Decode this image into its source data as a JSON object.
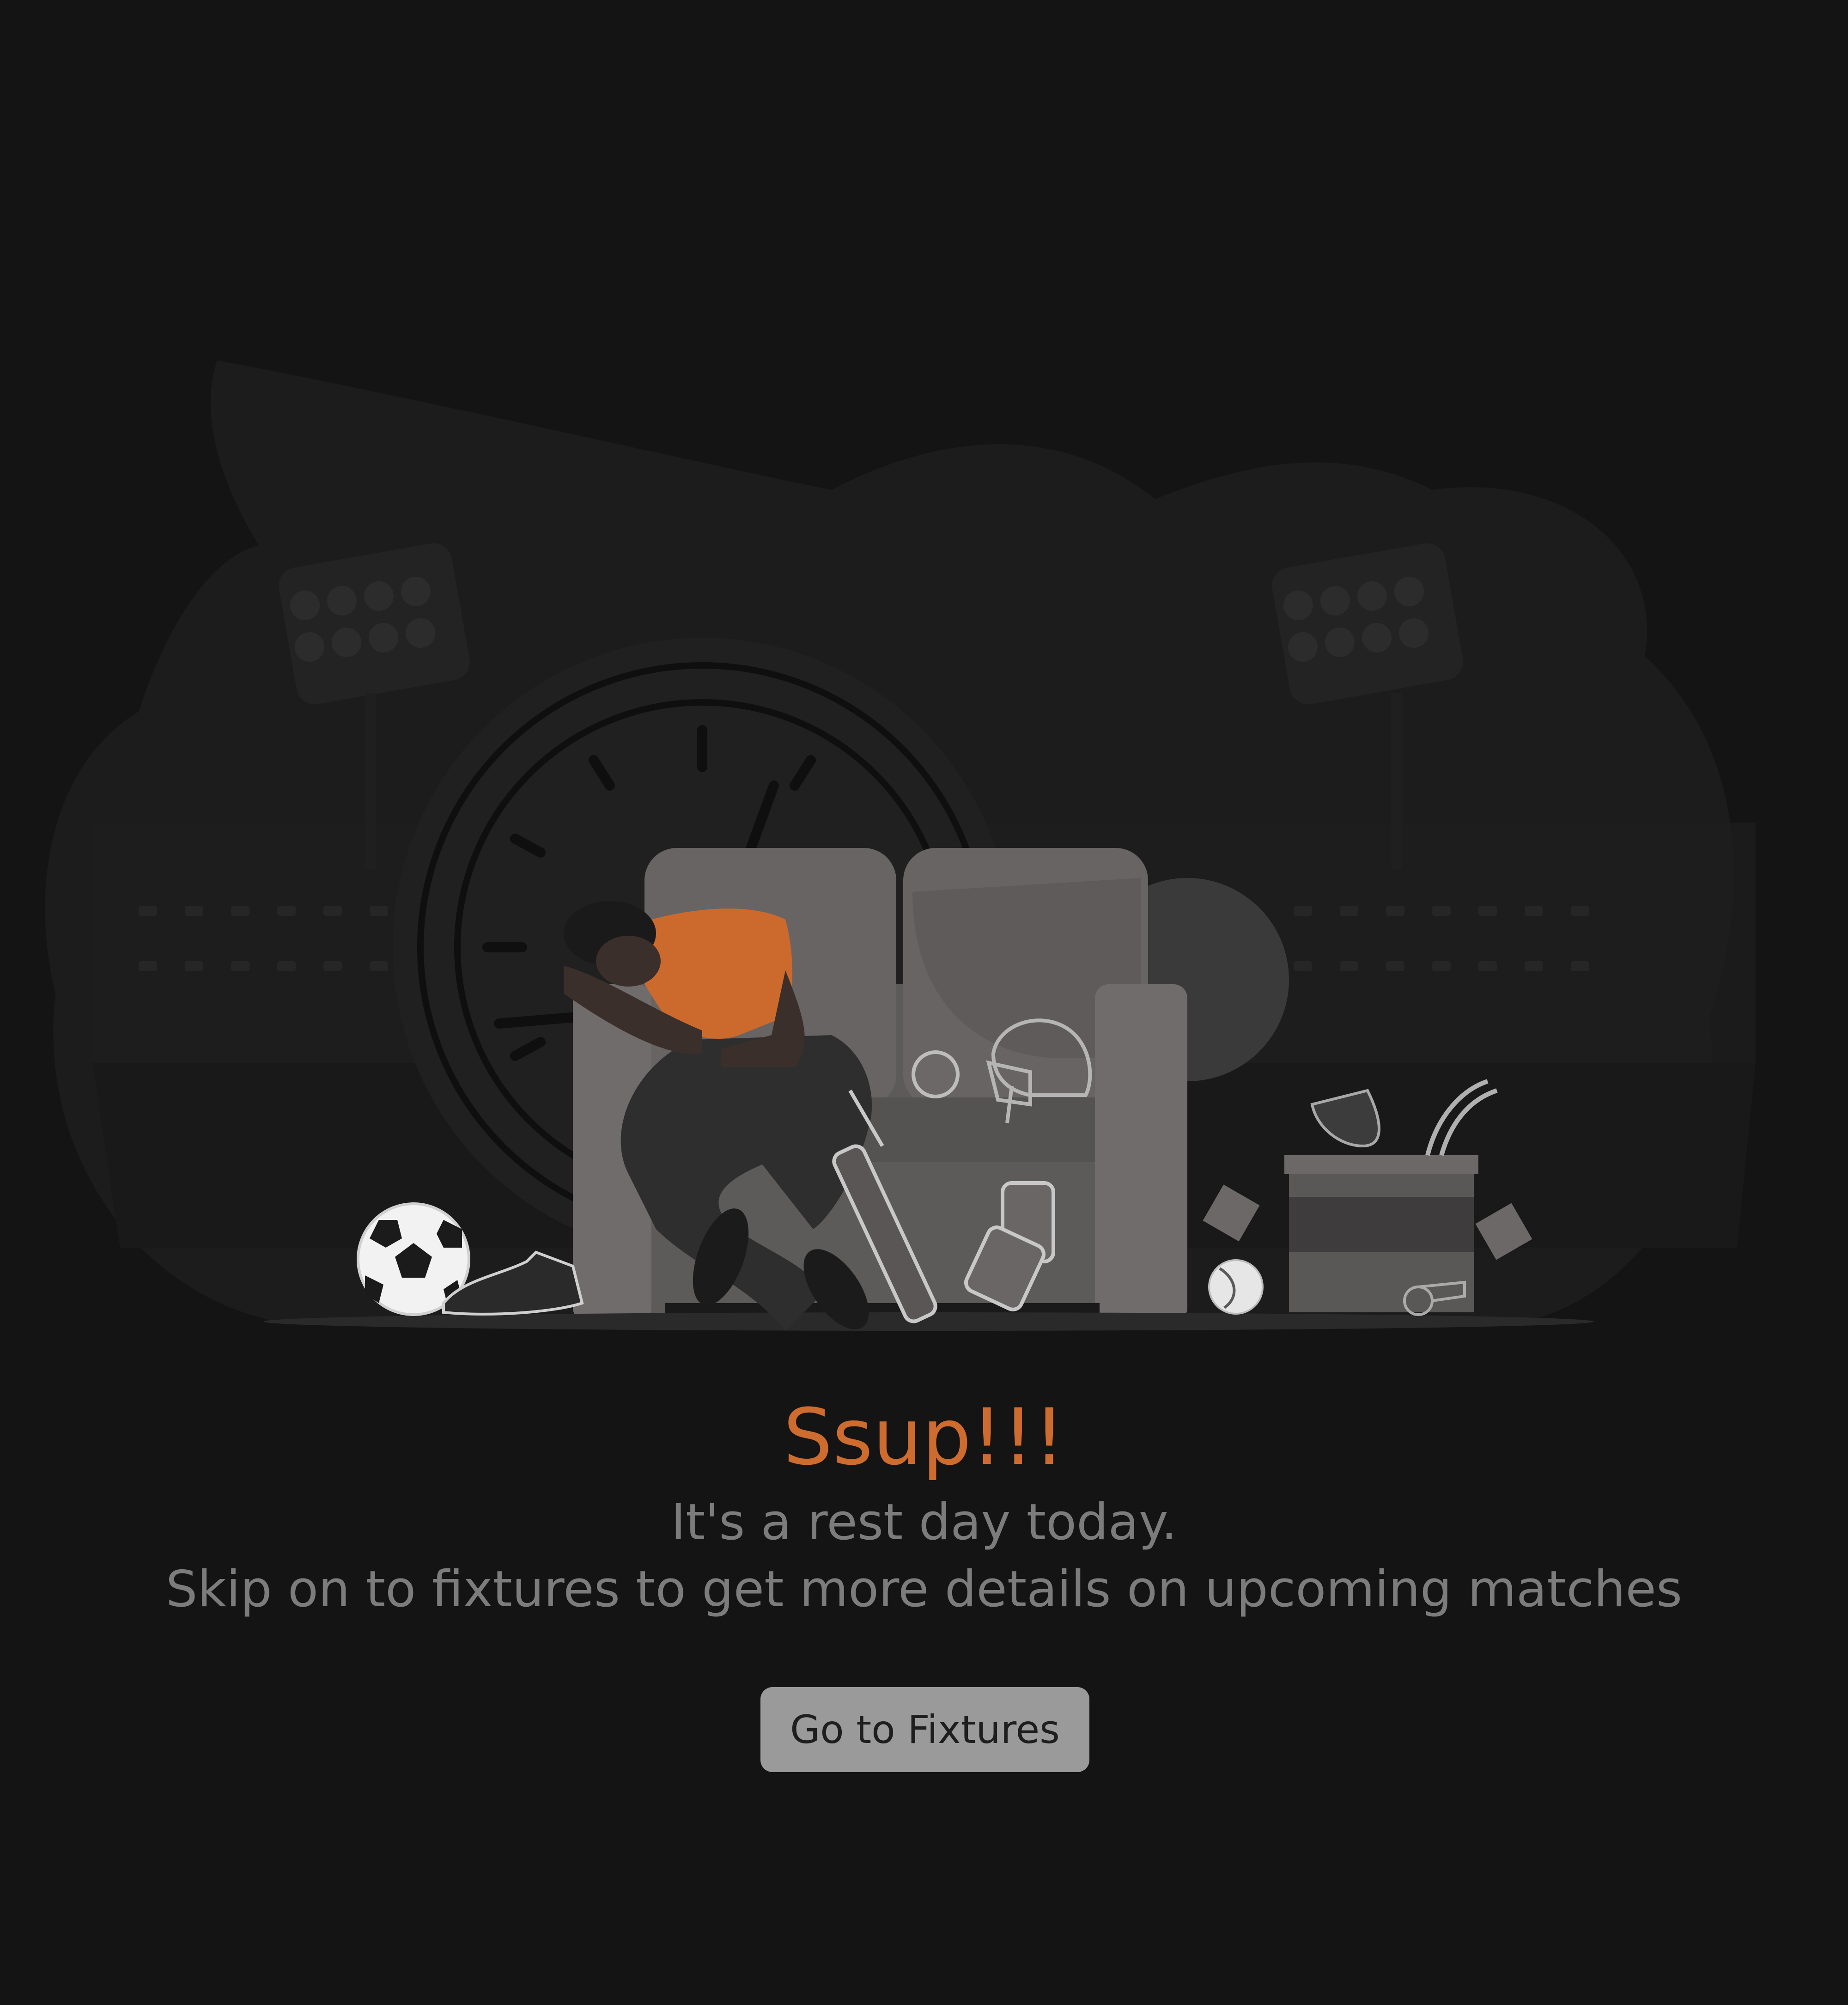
{
  "empty_state": {
    "title": "Ssup!!!",
    "line1": "It's a rest day today.",
    "line2": "Skip on to fixtures to get more details on upcoming matches",
    "button_label": "Go to Fixtures"
  },
  "colors": {
    "background": "#141414",
    "accent": "#ce6b2e",
    "muted_text": "#7c7c7c",
    "button_bg": "#9a9a9a",
    "button_text": "#1e1e1e"
  },
  "illustration": {
    "icons": [
      "stadium-background",
      "floodlight-icon",
      "clock-icon",
      "sofa-icon",
      "sleeping-player",
      "football-icon",
      "boot-icon",
      "cricket-bat-icon",
      "gloves-icon",
      "helmet-icon",
      "cricket-ball-icon",
      "trophy-icon",
      "tennis-ball-icon",
      "whistle-icon",
      "box-icon"
    ]
  }
}
